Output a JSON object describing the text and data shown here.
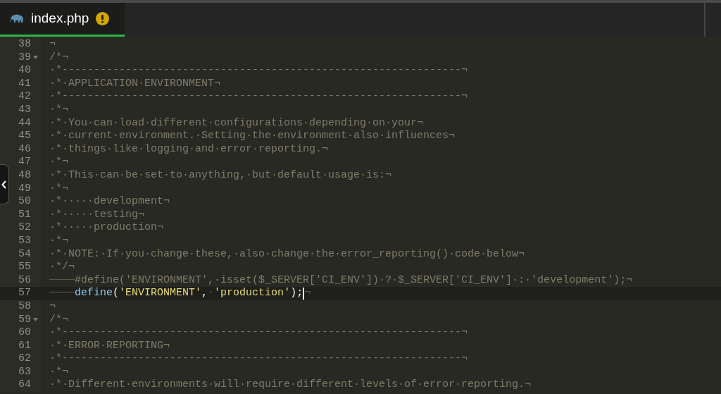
{
  "tab": {
    "title": "index.php",
    "selected": true,
    "warning": true
  },
  "lines": [
    {
      "number": "38",
      "foldable": false,
      "current": false,
      "tokens": [
        {
          "kind": "comment",
          "text": "¬"
        }
      ]
    },
    {
      "number": "39",
      "foldable": true,
      "current": false,
      "tokens": [
        {
          "kind": "comment",
          "text": "/*¬"
        }
      ]
    },
    {
      "number": "40",
      "foldable": false,
      "current": false,
      "tokens": [
        {
          "kind": "comment",
          "text": "·*---------------------------------------------------------------¬"
        }
      ]
    },
    {
      "number": "41",
      "foldable": false,
      "current": false,
      "tokens": [
        {
          "kind": "comment",
          "text": "·*·APPLICATION·ENVIRONMENT¬"
        }
      ]
    },
    {
      "number": "42",
      "foldable": false,
      "current": false,
      "tokens": [
        {
          "kind": "comment",
          "text": "·*---------------------------------------------------------------¬"
        }
      ]
    },
    {
      "number": "43",
      "foldable": false,
      "current": false,
      "tokens": [
        {
          "kind": "comment",
          "text": "·*¬"
        }
      ]
    },
    {
      "number": "44",
      "foldable": false,
      "current": false,
      "tokens": [
        {
          "kind": "comment",
          "text": "·*·You·can·load·different·configurations·depending·on·your¬"
        }
      ]
    },
    {
      "number": "45",
      "foldable": false,
      "current": false,
      "tokens": [
        {
          "kind": "comment",
          "text": "·*·current·environment.·Setting·the·environment·also·influences¬"
        }
      ]
    },
    {
      "number": "46",
      "foldable": false,
      "current": false,
      "tokens": [
        {
          "kind": "comment",
          "text": "·*·things·like·logging·and·error·reporting.¬"
        }
      ]
    },
    {
      "number": "47",
      "foldable": false,
      "current": false,
      "tokens": [
        {
          "kind": "comment",
          "text": "·*¬"
        }
      ]
    },
    {
      "number": "48",
      "foldable": false,
      "current": false,
      "tokens": [
        {
          "kind": "comment",
          "text": "·*·This·can·be·set·to·anything,·but·default·usage·is:¬"
        }
      ]
    },
    {
      "number": "49",
      "foldable": false,
      "current": false,
      "tokens": [
        {
          "kind": "comment",
          "text": "·*¬"
        }
      ]
    },
    {
      "number": "50",
      "foldable": false,
      "current": false,
      "tokens": [
        {
          "kind": "comment",
          "text": "·*·····development¬"
        }
      ]
    },
    {
      "number": "51",
      "foldable": false,
      "current": false,
      "tokens": [
        {
          "kind": "comment",
          "text": "·*·····testing¬"
        }
      ]
    },
    {
      "number": "52",
      "foldable": false,
      "current": false,
      "tokens": [
        {
          "kind": "comment",
          "text": "·*·····production¬"
        }
      ]
    },
    {
      "number": "53",
      "foldable": false,
      "current": false,
      "tokens": [
        {
          "kind": "comment",
          "text": "·*¬"
        }
      ]
    },
    {
      "number": "54",
      "foldable": false,
      "current": false,
      "tokens": [
        {
          "kind": "comment",
          "text": "·*·NOTE:·If·you·change·these,·also·change·the·error_reporting()·code·below¬"
        }
      ]
    },
    {
      "number": "55",
      "foldable": false,
      "current": false,
      "tokens": [
        {
          "kind": "comment",
          "text": "·*/¬"
        }
      ]
    },
    {
      "number": "56",
      "foldable": false,
      "current": false,
      "tokens": [
        {
          "kind": "whitespace",
          "text": "────"
        },
        {
          "kind": "comment",
          "text": "#define('ENVIRONMENT',·isset($_SERVER['CI_ENV'])·?·$_SERVER['CI_ENV']·:·'development');¬"
        }
      ]
    },
    {
      "number": "57",
      "foldable": false,
      "current": true,
      "tokens": [
        {
          "kind": "whitespace",
          "text": "────"
        },
        {
          "kind": "function",
          "text": "define"
        },
        {
          "kind": "punct",
          "text": "("
        },
        {
          "kind": "string",
          "text": "'ENVIRONMENT'"
        },
        {
          "kind": "punct",
          "text": ","
        },
        {
          "kind": "whitespace",
          "text": "·"
        },
        {
          "kind": "string",
          "text": "'production'"
        },
        {
          "kind": "punct",
          "text": ");"
        },
        {
          "kind": "cursor"
        },
        {
          "kind": "whitespace",
          "text": "¬"
        }
      ]
    },
    {
      "number": "58",
      "foldable": false,
      "current": false,
      "tokens": [
        {
          "kind": "comment",
          "text": "¬"
        }
      ]
    },
    {
      "number": "59",
      "foldable": true,
      "current": false,
      "tokens": [
        {
          "kind": "comment",
          "text": "/*¬"
        }
      ]
    },
    {
      "number": "60",
      "foldable": false,
      "current": false,
      "tokens": [
        {
          "kind": "comment",
          "text": "·*---------------------------------------------------------------¬"
        }
      ]
    },
    {
      "number": "61",
      "foldable": false,
      "current": false,
      "tokens": [
        {
          "kind": "comment",
          "text": "·*·ERROR·REPORTING¬"
        }
      ]
    },
    {
      "number": "62",
      "foldable": false,
      "current": false,
      "tokens": [
        {
          "kind": "comment",
          "text": "·*---------------------------------------------------------------¬"
        }
      ]
    },
    {
      "number": "63",
      "foldable": false,
      "current": false,
      "tokens": [
        {
          "kind": "comment",
          "text": "·*¬"
        }
      ]
    },
    {
      "number": "64",
      "foldable": false,
      "current": false,
      "tokens": [
        {
          "kind": "comment",
          "text": "·*·Different·environments·will·require·different·levels·of·error·reporting.¬"
        }
      ]
    }
  ]
}
